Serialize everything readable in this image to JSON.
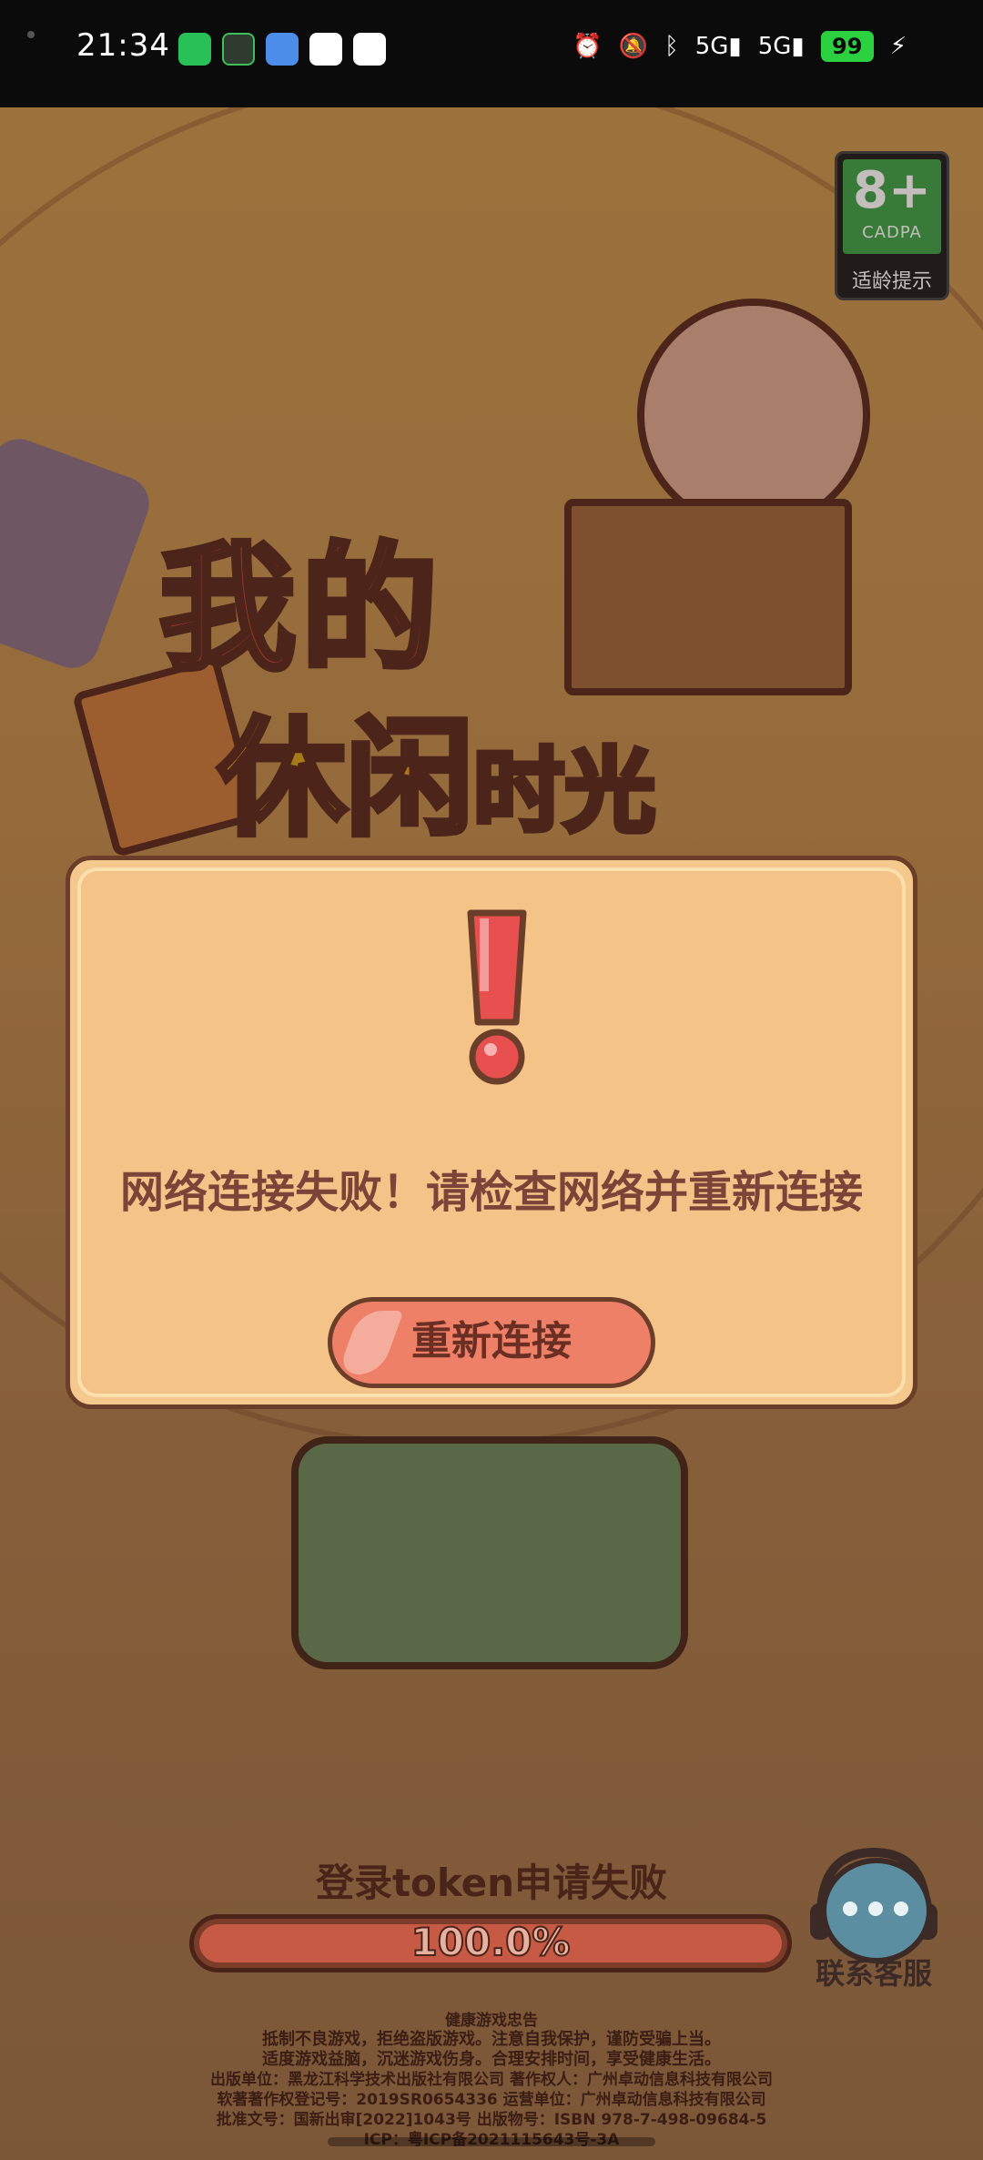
{
  "status_bar": {
    "time": "21:34",
    "app_icons": [
      "wechat-icon",
      "cube-app-icon",
      "weather-icon",
      "shield-icon",
      "umbrella-icon"
    ],
    "system_icons": [
      "alarm-icon",
      "mute-icon",
      "bluetooth-icon",
      "signal-5g-icon",
      "signal-5g-icon"
    ],
    "signal_label_1": "5G",
    "signal_label_2": "5G",
    "battery": "99"
  },
  "game": {
    "title_line1": "我的",
    "title_line2a": "休闲",
    "title_line2b": "时光",
    "age_rating": "8+",
    "age_org": "CADPA",
    "age_hint": "适龄提示"
  },
  "dialog": {
    "message": "网络连接失败！请检查网络并重新连接",
    "retry_label": "重新连接"
  },
  "loading": {
    "status_text": "登录token申请失败",
    "progress_text": "100.0%",
    "progress_value": 1.0
  },
  "customer_service": {
    "label": "联系客服"
  },
  "footer": {
    "heading": "健康游戏忠告",
    "line1": "抵制不良游戏，拒绝盗版游戏。注意自我保护，谨防受骗上当。",
    "line2": "适度游戏益脑，沉迷游戏伤身。合理安排时间，享受健康生活。",
    "line3": "出版单位：黑龙江科学技术出版社有限公司   著作权人：广州卓动信息科技有限公司",
    "line4": "软著著作权登记号：2019SR0654336   运营单位：广州卓动信息科技有限公司",
    "line5": "批准文号：国新出审[2022]1043号   出版物号：ISBN 978-7-498-09684-5",
    "line6": "ICP：粤ICP备2021115643号-3A"
  },
  "colors": {
    "accent": "#ee8068",
    "dialog_bg": "#f5c98d",
    "text_brown": "#7a4438"
  }
}
